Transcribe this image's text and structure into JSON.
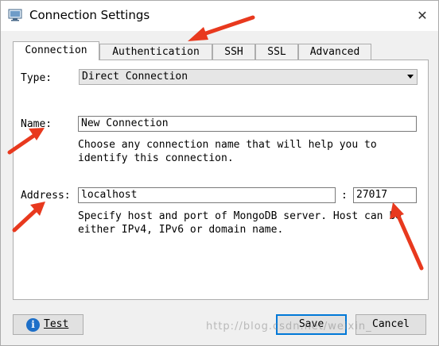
{
  "window": {
    "title": "Connection Settings",
    "close_glyph": "✕",
    "icon": "monitor-icon"
  },
  "tabs": [
    {
      "label": "Connection",
      "active": true
    },
    {
      "label": "Authentication",
      "active": false
    },
    {
      "label": "SSH",
      "active": false
    },
    {
      "label": "SSL",
      "active": false
    },
    {
      "label": "Advanced",
      "active": false
    }
  ],
  "form": {
    "type_label": "Type:",
    "type_value": "Direct Connection",
    "name_label": "Name:",
    "name_value": "New Connection",
    "name_hint": "Choose any connection name that will help you to\nidentify this connection.",
    "address_label": "Address:",
    "host_value": "localhost",
    "port_separator": ":",
    "port_value": "27017",
    "address_hint": "Specify host and port of MongoDB server. Host can be\neither IPv4, IPv6 or domain name."
  },
  "buttons": {
    "test_label": "Test",
    "test_icon": "info-icon",
    "save_label": "Save",
    "cancel_label": "Cancel"
  },
  "annotations": {
    "arrow_color": "#e8391e"
  },
  "watermark": "http://blog.csdn.net/weixin_"
}
